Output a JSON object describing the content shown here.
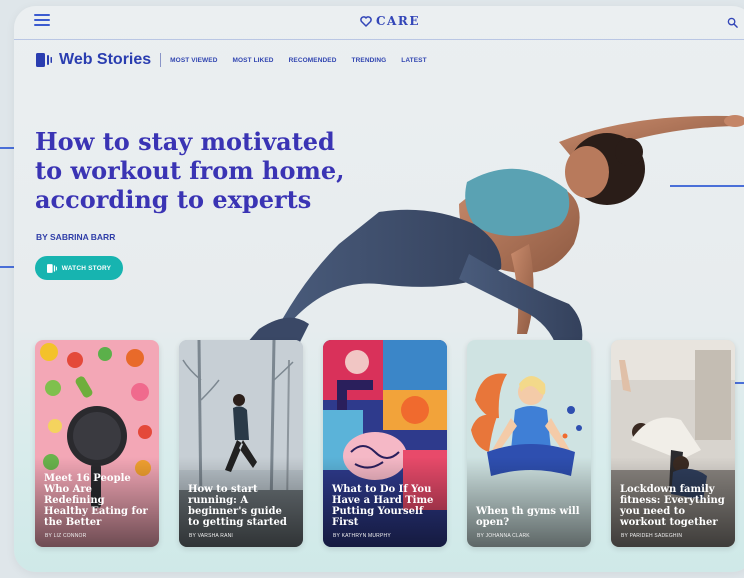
{
  "header": {
    "brand": "CARE"
  },
  "subnav": {
    "title": "Web Stories",
    "links": [
      "MOST VIEWED",
      "MOST LIKED",
      "RECOMENDED",
      "TRENDING",
      "LATEST"
    ]
  },
  "hero": {
    "title": "How to stay motivated to workout from home, according to experts",
    "byline": "BY SABRINA BARR",
    "cta": "WATCH STORY"
  },
  "cards": [
    {
      "title": "Meet 16 People Who Are Redefining Healthy Eating for the Better",
      "author": "BY LIZ CONNOR"
    },
    {
      "title": "How to start running: A beginner's guide to getting started",
      "author": "BY VARSHA RANI"
    },
    {
      "title": "What to Do If You Have a Hard Time Putting Yourself First",
      "author": "BY KATHRYN MURPHY"
    },
    {
      "title": "When th gyms will open?",
      "author": "BY JOHANNA CLARK"
    },
    {
      "title": "Lockdown family fitness: Everything you need to workout together",
      "author": "BY PARIDEH SADEGHIN"
    }
  ],
  "colors": {
    "accent": "#3a34b4",
    "cta": "#17b4b0",
    "nav": "#3145b0"
  }
}
